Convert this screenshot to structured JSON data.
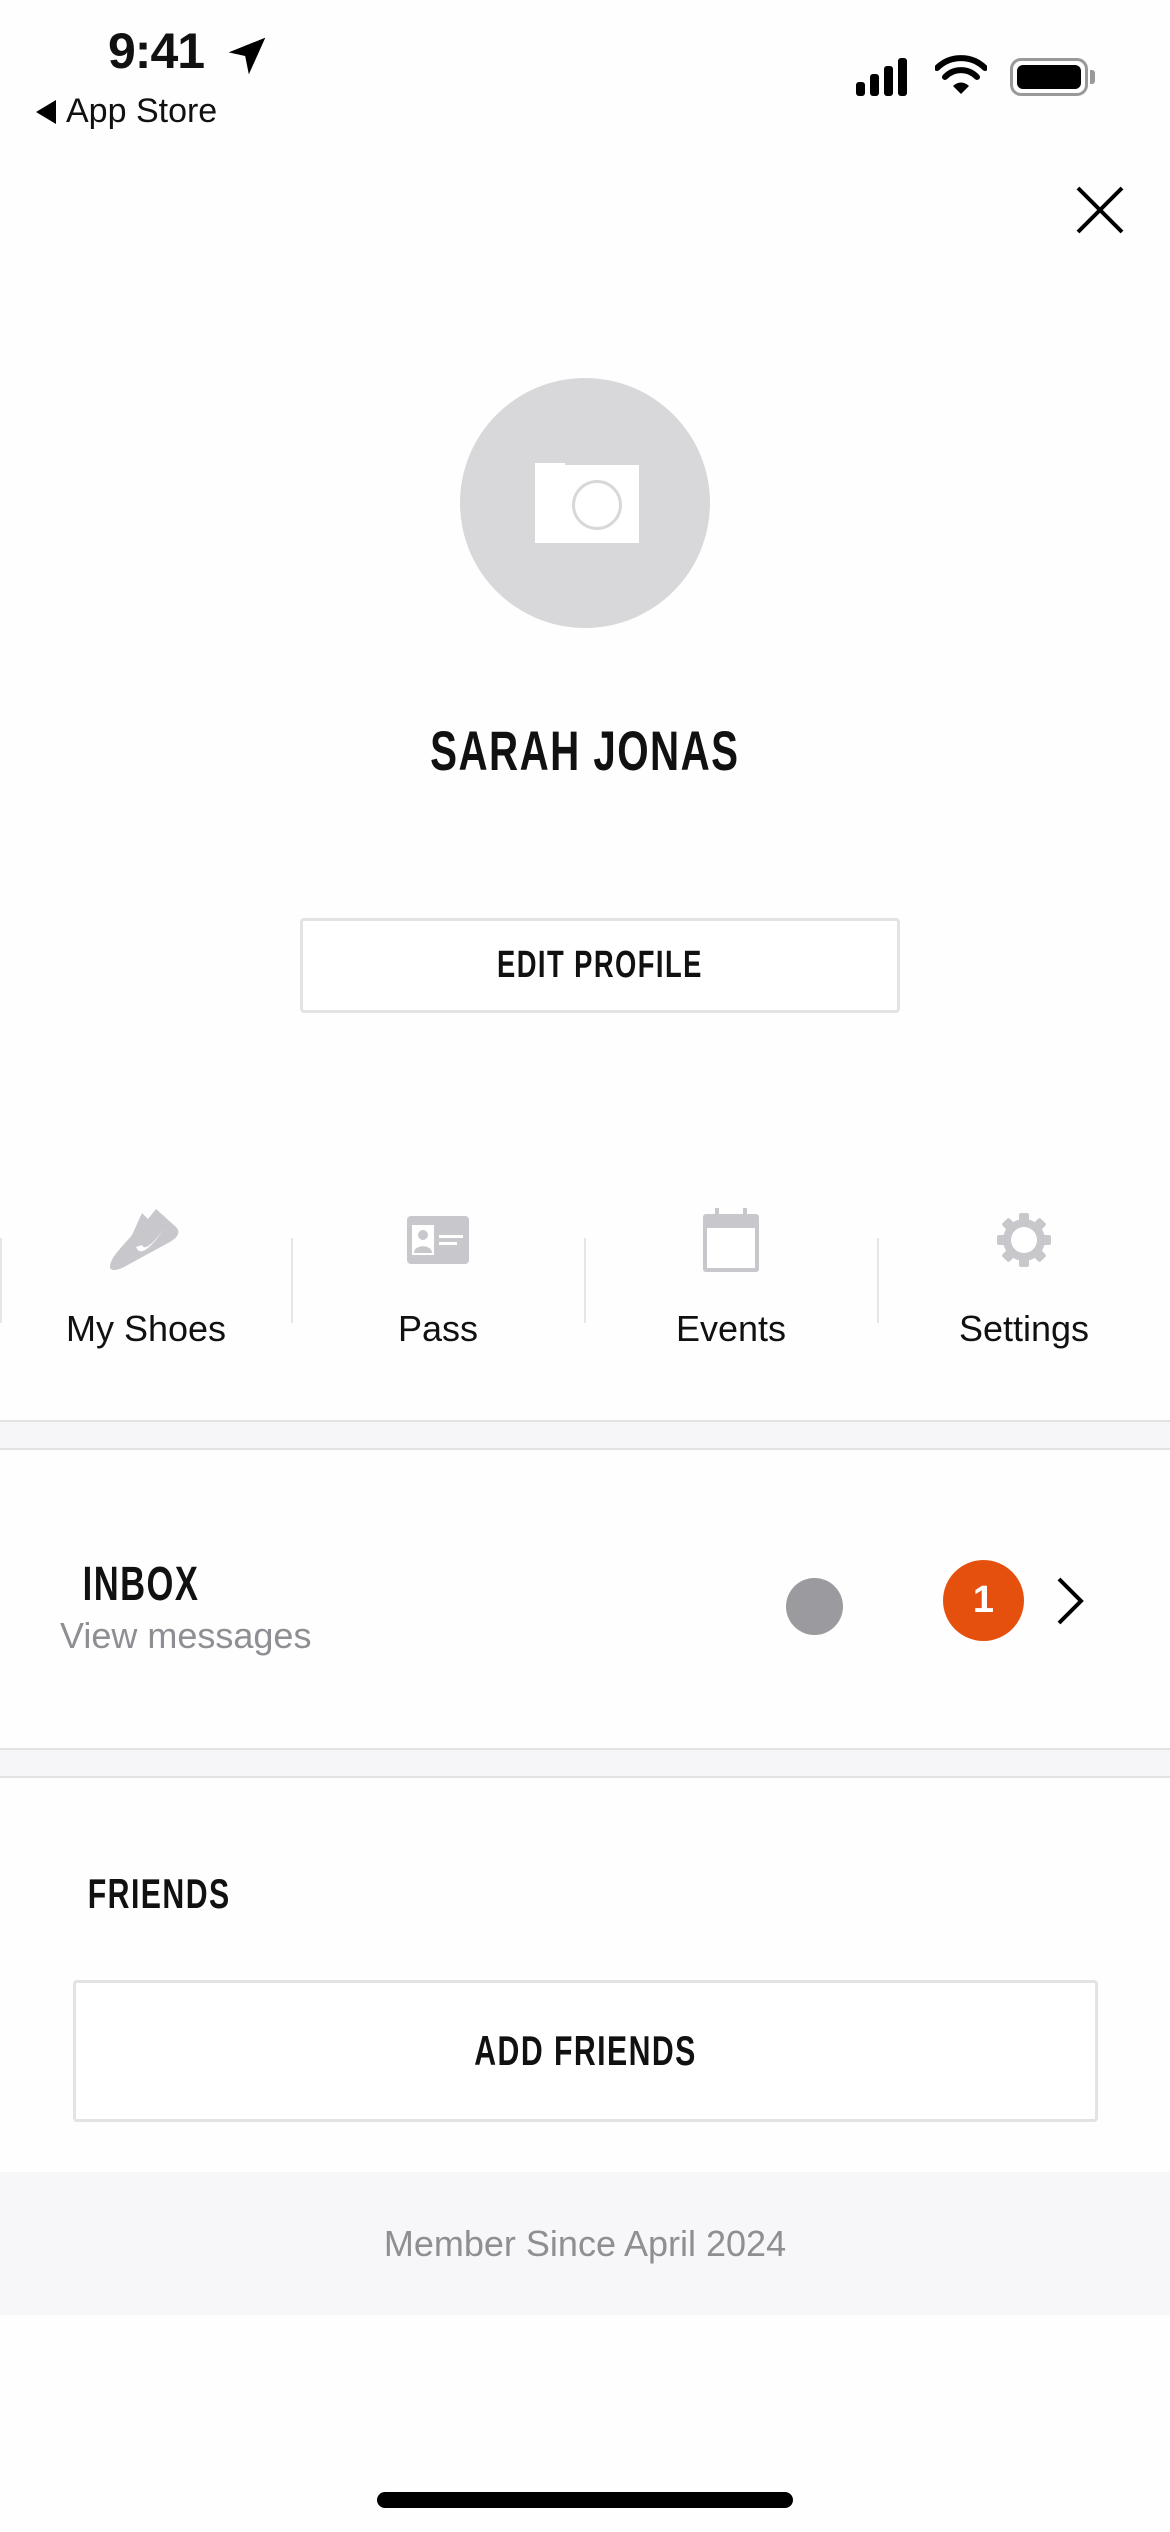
{
  "status_bar": {
    "time": "9:41",
    "back_label": "App Store",
    "icons": [
      "location-arrow-icon",
      "cellular-signal-icon",
      "wifi-icon",
      "battery-icon"
    ]
  },
  "header": {
    "close_icon": "close-icon"
  },
  "profile": {
    "avatar_icon": "camera-icon",
    "name": "SARAH JONAS",
    "edit_label": "EDIT PROFILE"
  },
  "shortcuts": [
    {
      "label": "My Shoes",
      "icon": "shoe-icon"
    },
    {
      "label": "Pass",
      "icon": "id-card-icon"
    },
    {
      "label": "Events",
      "icon": "calendar-icon"
    },
    {
      "label": "Settings",
      "icon": "gear-icon"
    }
  ],
  "inbox": {
    "title": "INBOX",
    "subtitle": "View messages",
    "badge_count": "1",
    "badge_color": "#e5500f"
  },
  "friends": {
    "title": "FRIENDS",
    "add_label": "ADD FRIENDS"
  },
  "footer": {
    "member_since": "Member Since April 2024"
  }
}
